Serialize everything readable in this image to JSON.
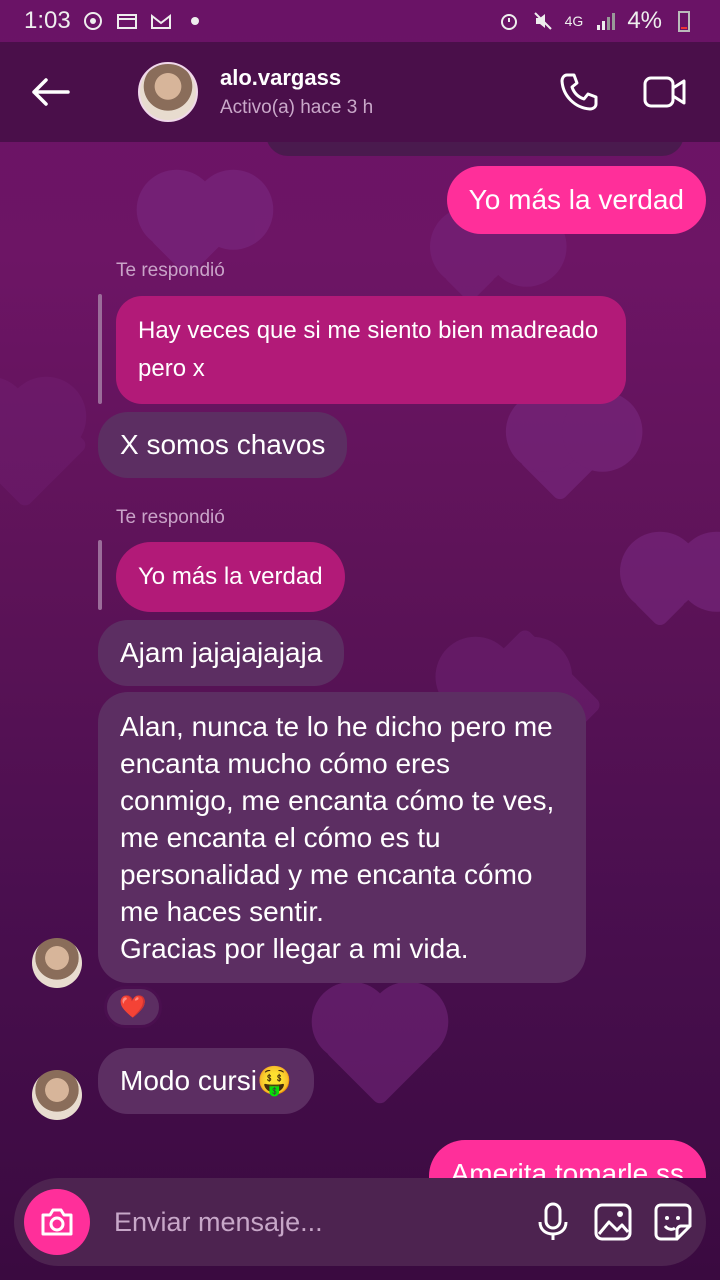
{
  "status_bar": {
    "time": "1:03",
    "network": "4G",
    "battery": "4%"
  },
  "header": {
    "name": "alo.vargass",
    "status": "Activo(a) hace 3 h"
  },
  "messages": {
    "sent_1": "Yo más la verdad",
    "reply_label_1": "Te respondió",
    "quoted_1": "Hay veces que si me siento bien madreado pero x",
    "recv_1": "X somos chavos",
    "reply_label_2": "Te respondió",
    "quoted_2": "Yo más la verdad",
    "recv_2": "Ajam jajajajajaja",
    "recv_3": "Alan, nunca te lo he dicho pero me encanta mucho cómo eres conmigo, me encanta cómo te ves, me encanta el cómo es tu personalidad y me encanta cómo me haces sentir.\nGracias por llegar a mi vida.",
    "reaction": "❤️",
    "recv_4": "Modo cursi🤑",
    "sent_2": "Amerita tomarle ss"
  },
  "composer": {
    "placeholder": "Enviar mensaje..."
  },
  "colors": {
    "accent": "#ff2f9a",
    "received": "#5c2e62",
    "quoted": "#b21a78",
    "header": "#4a0f4a"
  },
  "icons": [
    "back-arrow-icon",
    "phone-icon",
    "video-icon",
    "camera-icon",
    "microphone-icon",
    "gallery-icon",
    "sticker-icon"
  ]
}
